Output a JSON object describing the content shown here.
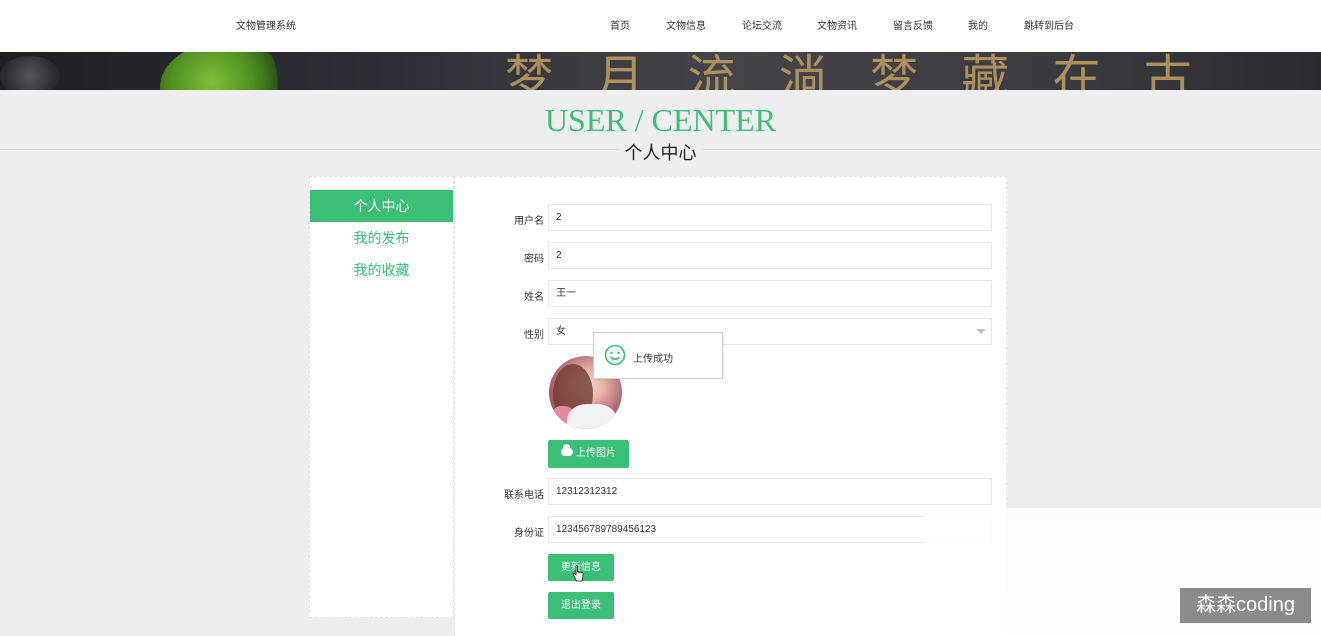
{
  "header": {
    "site_title": "文物管理系统",
    "nav": [
      {
        "label": "首页"
      },
      {
        "label": "文物信息"
      },
      {
        "label": "论坛交流"
      },
      {
        "label": "文物资讯"
      },
      {
        "label": "留言反馈"
      },
      {
        "label": "我的"
      },
      {
        "label": "跳转到后台"
      }
    ]
  },
  "banner": {
    "text": "梦 月 流 淌  梦 藏 在 古"
  },
  "section": {
    "en_title": "USER / CENTER",
    "cn_title": "个人中心"
  },
  "sidebar": {
    "items": [
      {
        "label": "个人中心",
        "active": true
      },
      {
        "label": "我的发布",
        "active": false
      },
      {
        "label": "我的收藏",
        "active": false
      }
    ]
  },
  "form": {
    "username": {
      "label": "用户名",
      "value": "2"
    },
    "password": {
      "label": "密码",
      "value": "2"
    },
    "name": {
      "label": "姓名",
      "value": "王一"
    },
    "gender": {
      "label": "性别",
      "value": "女"
    },
    "upload_button": "上传图片",
    "phone": {
      "label": "联系电话",
      "value": "12312312312"
    },
    "id_card": {
      "label": "身份证",
      "value": "123456789789456123"
    },
    "update_button": "更新信息",
    "logout_button": "退出登录"
  },
  "toast": {
    "message": "上传成功"
  },
  "watermark": "森森coding",
  "colors": {
    "accent": "#3bbf77",
    "page_bg": "#eeeef0"
  }
}
